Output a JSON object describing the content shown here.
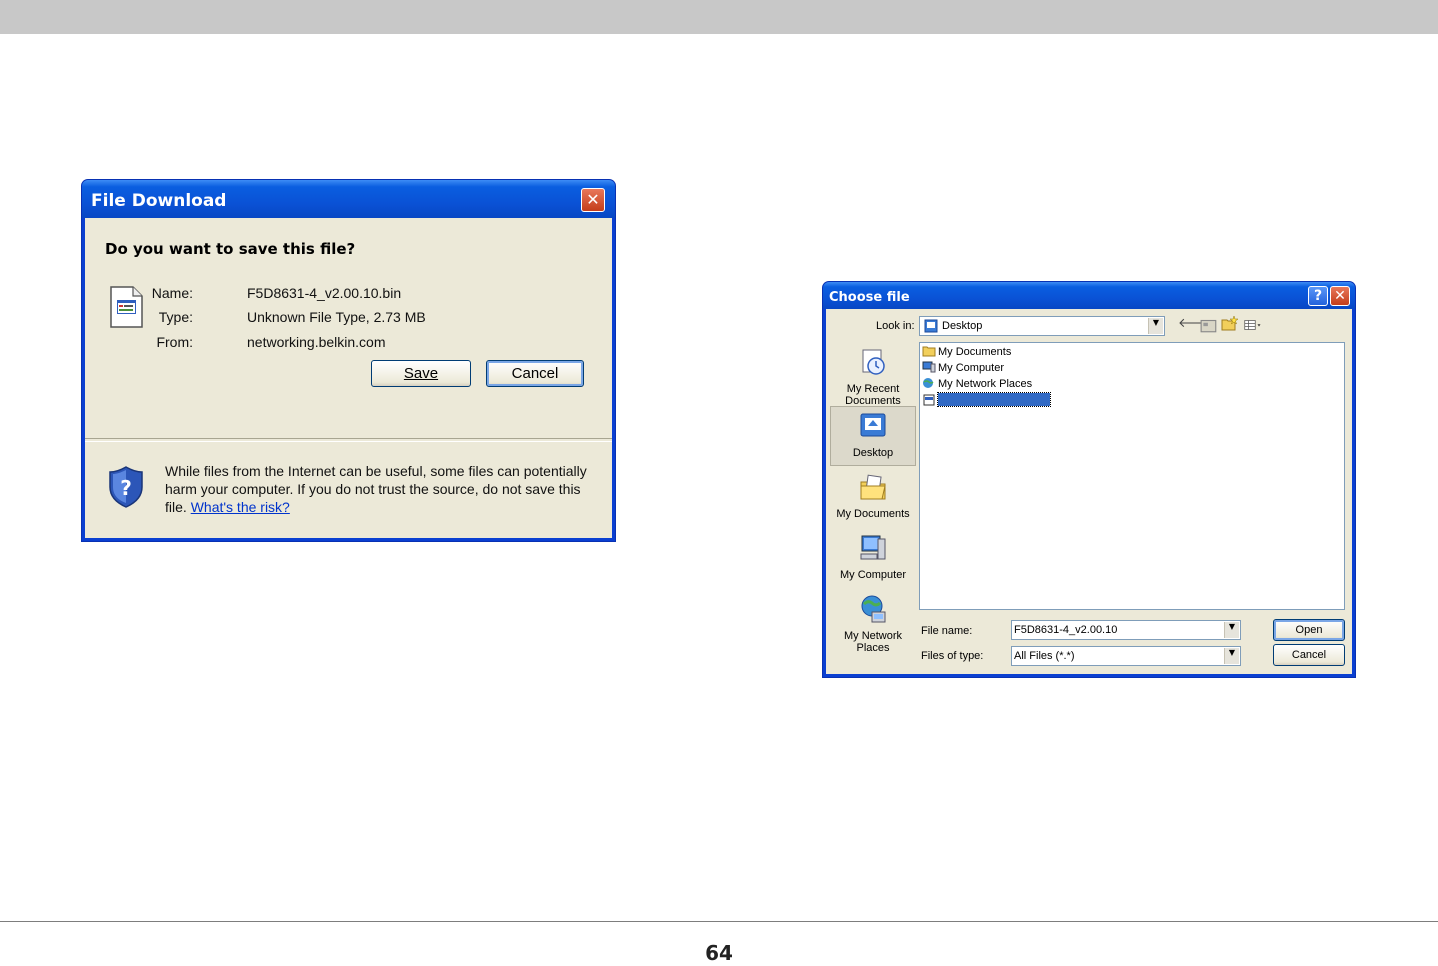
{
  "page": {
    "page_number": "64"
  },
  "file_download": {
    "title": "File Download",
    "close_symbol": "✕",
    "question": "Do you want to save this file?",
    "fields": [
      {
        "label": "Name:",
        "value": "F5D8631-4_v2.00.10.bin"
      },
      {
        "label": "Type:",
        "value": "Unknown File Type, 2.73 MB"
      },
      {
        "label": "From:",
        "value": "networking.belkin.com"
      }
    ],
    "save_label": "Save",
    "cancel_label": "Cancel",
    "warning_text": "While files from the Internet can be useful, some files can potentially harm your computer. If you do not trust the source, do not save this file.",
    "risk_link": "What's the risk?",
    "icons": {
      "file": "file-icon",
      "shield": "security-shield-icon"
    }
  },
  "choose_file": {
    "title": "Choose file",
    "help_symbol": "?",
    "close_symbol": "✕",
    "look_in_label": "Look in:",
    "look_in_value": "Desktop",
    "places": [
      {
        "label": "My Recent Documents",
        "icon": "recent-documents-icon"
      },
      {
        "label": "Desktop",
        "icon": "desktop-icon"
      },
      {
        "label": "My Documents",
        "icon": "my-documents-icon"
      },
      {
        "label": "My Computer",
        "icon": "my-computer-icon"
      },
      {
        "label": "My Network Places",
        "icon": "network-places-icon"
      }
    ],
    "files": [
      {
        "name": "My Documents",
        "icon": "folder-icon"
      },
      {
        "name": "My Computer",
        "icon": "computer-icon"
      },
      {
        "name": "My Network Places",
        "icon": "network-icon"
      },
      {
        "name": "",
        "icon": "file-icon",
        "selected": true
      }
    ],
    "file_name_label": "File name:",
    "file_name_value": "F5D8631-4_v2.00.10",
    "file_type_label": "Files of type:",
    "file_type_value": "All Files (*.*)",
    "open_label": "Open",
    "cancel_label": "Cancel",
    "toolbar_icons": [
      "back-icon",
      "up-folder-icon",
      "new-folder-icon",
      "views-menu-icon"
    ]
  }
}
